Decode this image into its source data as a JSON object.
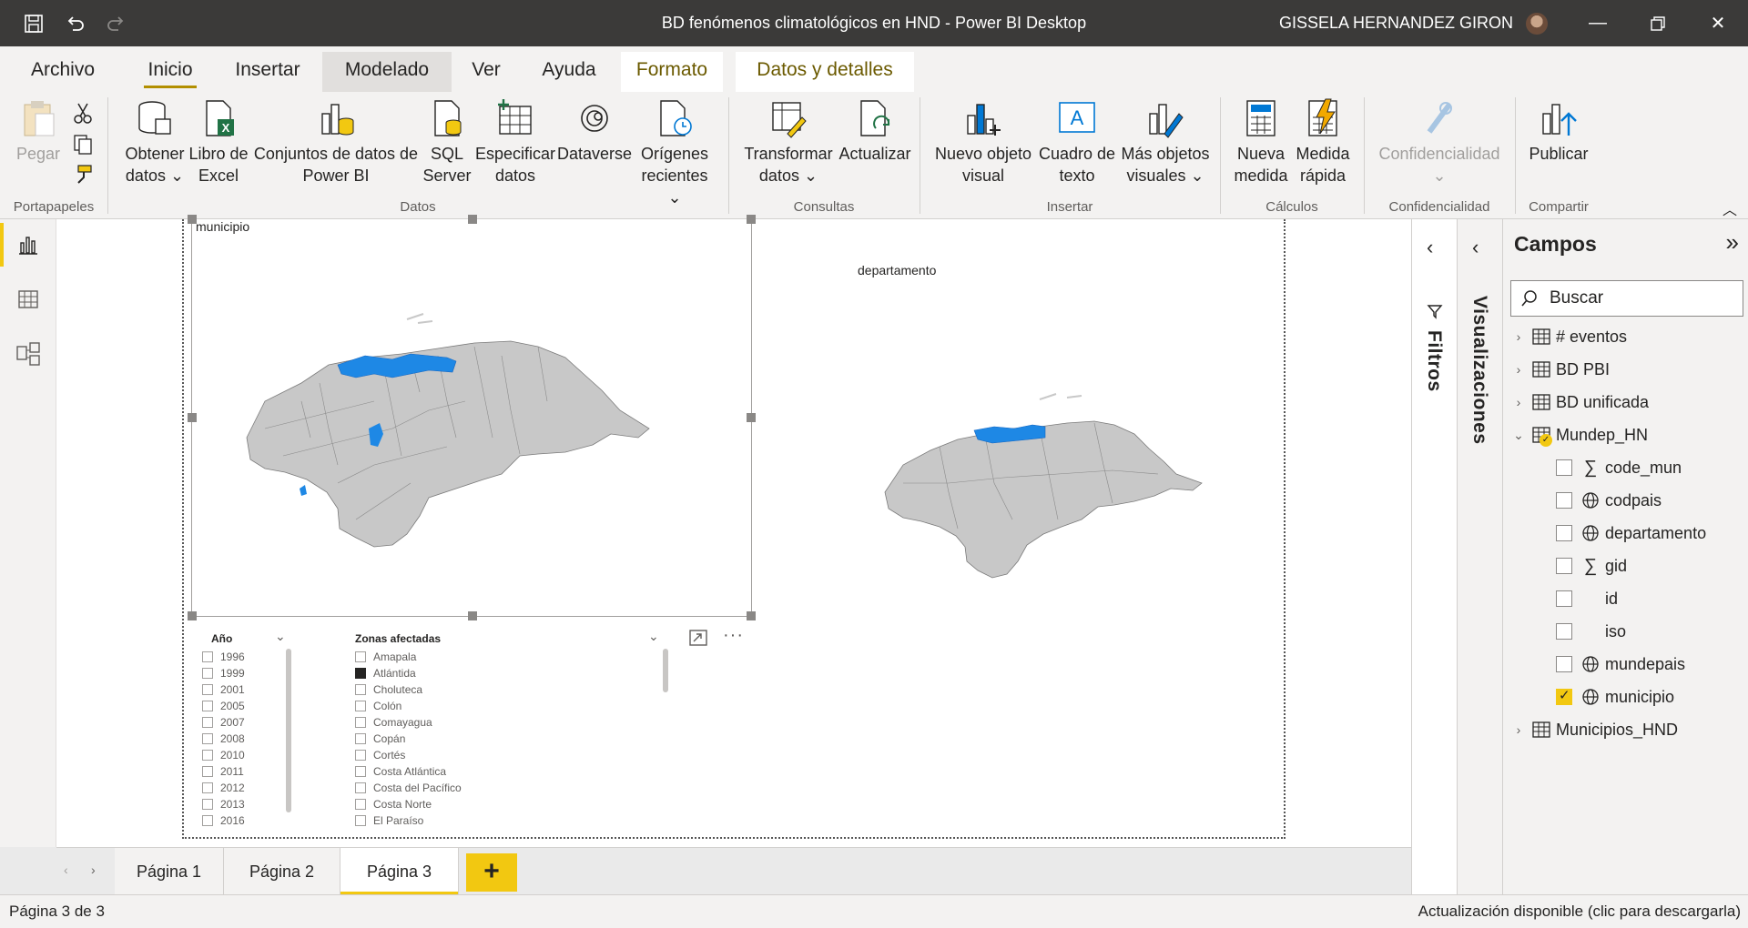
{
  "window": {
    "title": "BD fenómenos climatológicos en HND - Power BI Desktop",
    "user": "GISSELA HERNANDEZ GIRON"
  },
  "menu": {
    "tabs": [
      "Archivo",
      "Inicio",
      "Insertar",
      "Modelado",
      "Ver",
      "Ayuda",
      "Formato",
      "Datos y detalles"
    ]
  },
  "ribbon": {
    "paste": "Pegar",
    "get_data_1": "Obtener",
    "get_data_2": "datos",
    "excel_1": "Libro de",
    "excel_2": "Excel",
    "datasets_1": "Conjuntos de datos de",
    "datasets_2": "Power BI",
    "sql_1": "SQL",
    "sql_2": "Server",
    "enter_1": "Especificar",
    "enter_2": "datos",
    "dataverse": "Dataverse",
    "recent_1": "Orígenes",
    "recent_2": "recientes",
    "transform_1": "Transformar",
    "transform_2": "datos",
    "refresh": "Actualizar",
    "new_visual_1": "Nuevo objeto",
    "new_visual_2": "visual",
    "textbox_1": "Cuadro de",
    "textbox_2": "texto",
    "more_visuals_1": "Más objetos",
    "more_visuals_2": "visuales",
    "new_measure_1": "Nueva",
    "new_measure_2": "medida",
    "quick_measure_1": "Medida",
    "quick_measure_2": "rápida",
    "sensitivity": "Confidencialidad",
    "publish": "Publicar",
    "groups": {
      "clipboard": "Portapapeles",
      "data": "Datos",
      "queries": "Consultas",
      "insert": "Insertar",
      "calculations": "Cálculos",
      "sensitivity": "Confidencialidad",
      "share": "Compartir"
    }
  },
  "canvas": {
    "map1_title": "municipio",
    "map2_title": "departamento",
    "slicer_year": {
      "title": "Año",
      "items": [
        "1996",
        "1999",
        "2001",
        "2005",
        "2007",
        "2008",
        "2010",
        "2011",
        "2012",
        "2013",
        "2016"
      ]
    },
    "slicer_zones": {
      "title": "Zonas afectadas",
      "items": [
        "Amapala",
        "Atlántida",
        "Choluteca",
        "Colón",
        "Comayagua",
        "Copán",
        "Cortés",
        "Costa Atlántica",
        "Costa del Pacífico",
        "Costa Norte",
        "El Paraíso"
      ],
      "checked_index": 1
    }
  },
  "pages": {
    "tabs": [
      "Página 1",
      "Página 2",
      "Página 3"
    ],
    "active_index": 2,
    "add": "+"
  },
  "status": {
    "page": "Página 3 de 3",
    "update": "Actualización disponible (clic para descargarla)"
  },
  "panes": {
    "filters": "Filtros",
    "visualizations": "Visualizaciones",
    "fields": {
      "title": "Campos",
      "search_placeholder": "Buscar",
      "tables": [
        {
          "name": "# eventos",
          "expanded": false
        },
        {
          "name": "BD PBI",
          "expanded": false
        },
        {
          "name": "BD unificada",
          "expanded": false
        },
        {
          "name": "Mundep_HN",
          "expanded": true
        },
        {
          "name": "Municipios_HND",
          "expanded": false
        }
      ],
      "mundep_fields": [
        {
          "name": "code_mun",
          "icon": "sigma-icon",
          "checked": false
        },
        {
          "name": "codpais",
          "icon": "globe-icon",
          "checked": false
        },
        {
          "name": "departamento",
          "icon": "globe-icon",
          "checked": false
        },
        {
          "name": "gid",
          "icon": "sigma-icon",
          "checked": false
        },
        {
          "name": "id",
          "icon": "",
          "checked": false
        },
        {
          "name": "iso",
          "icon": "",
          "checked": false
        },
        {
          "name": "mundepais",
          "icon": "globe-icon",
          "checked": false
        },
        {
          "name": "municipio",
          "icon": "globe-icon",
          "checked": true
        }
      ]
    }
  },
  "colors": {
    "accent": "#f2c811",
    "highlight_region": "#1e88e5",
    "map_fill": "#c8c8c8"
  }
}
